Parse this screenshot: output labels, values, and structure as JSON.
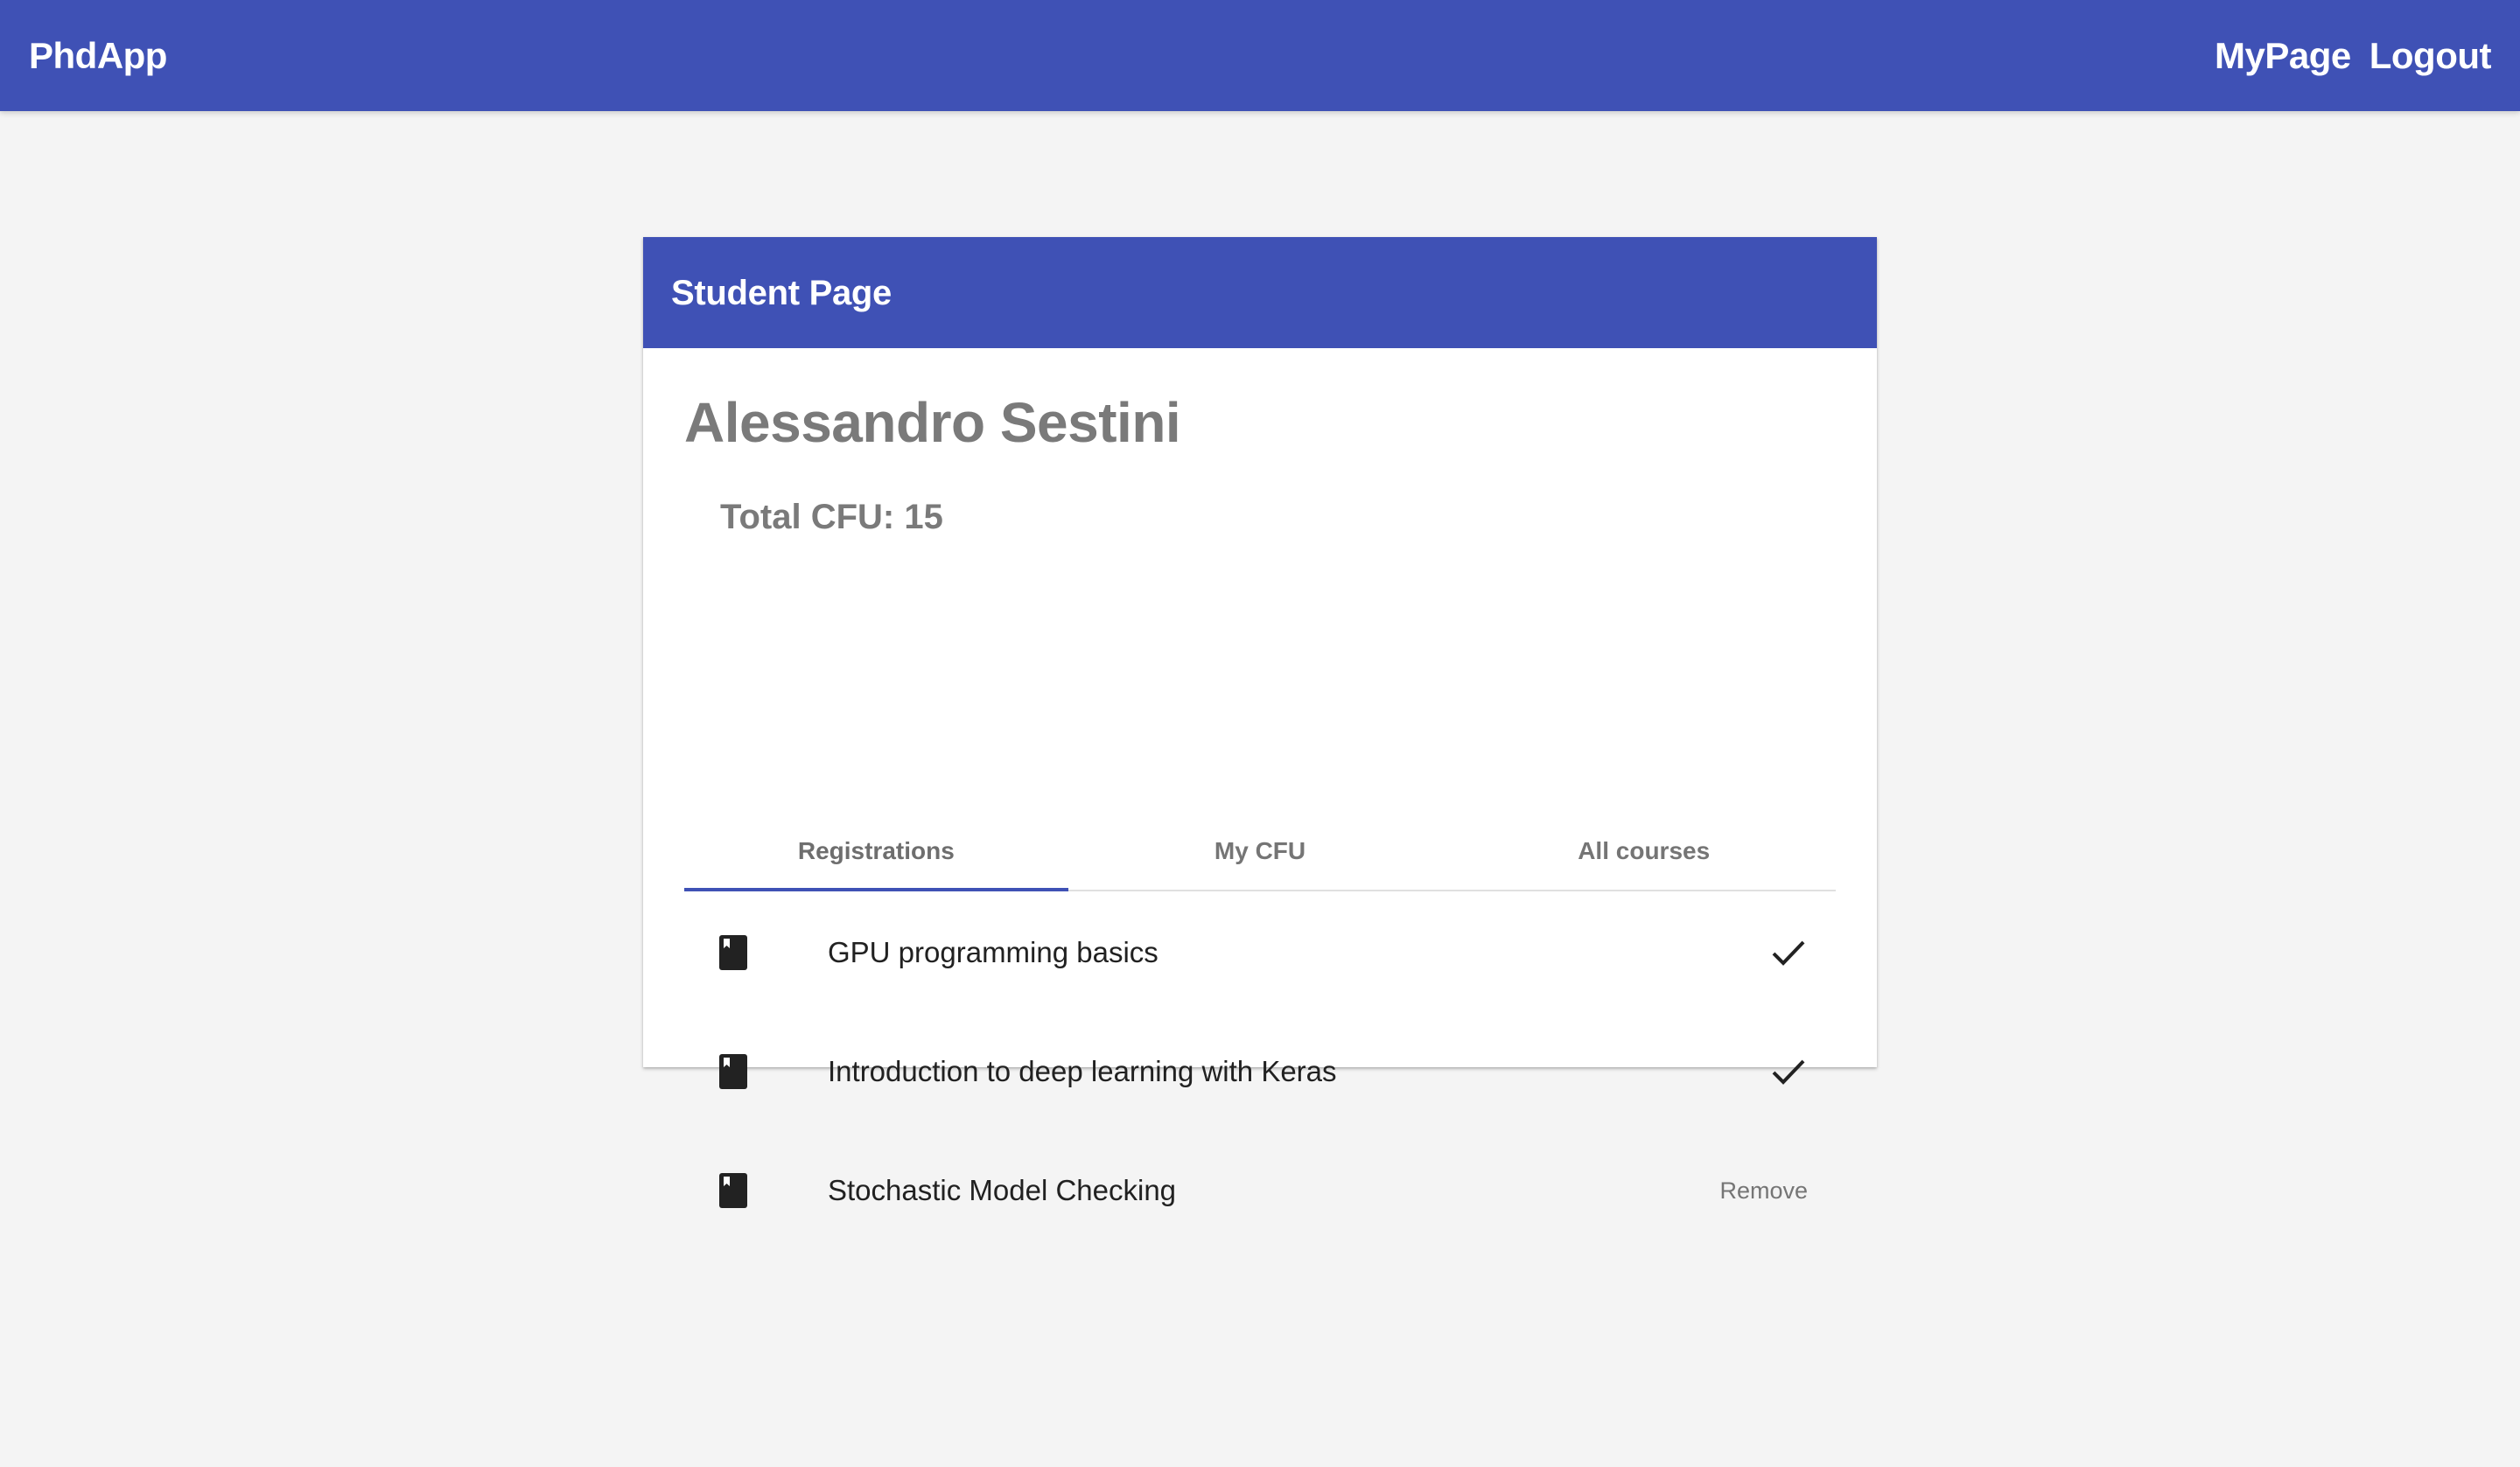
{
  "app": {
    "title": "PhdApp"
  },
  "nav": {
    "mypage_label": "MyPage",
    "logout_label": "Logout"
  },
  "card": {
    "title": "Student Page",
    "student_name": "Alessandro Sestini",
    "total_cfu": "Total CFU: 15"
  },
  "tabs": [
    {
      "label": "Registrations",
      "active": true
    },
    {
      "label": "My CFU",
      "active": false
    },
    {
      "label": "All courses",
      "active": false
    }
  ],
  "registrations": [
    {
      "name": "GPU programming basics",
      "status": "completed",
      "icon": "book-icon",
      "action_icon": "check-icon"
    },
    {
      "name": "Introduction to deep learning with Keras",
      "status": "completed",
      "icon": "book-icon",
      "action_icon": "check-icon"
    },
    {
      "name": "Stochastic Model Checking",
      "status": "registered",
      "icon": "book-icon",
      "action_label": "Remove"
    }
  ],
  "colors": {
    "primary": "#3f51b5",
    "background": "#f4f4f4",
    "muted_text": "#7a7a7a"
  }
}
